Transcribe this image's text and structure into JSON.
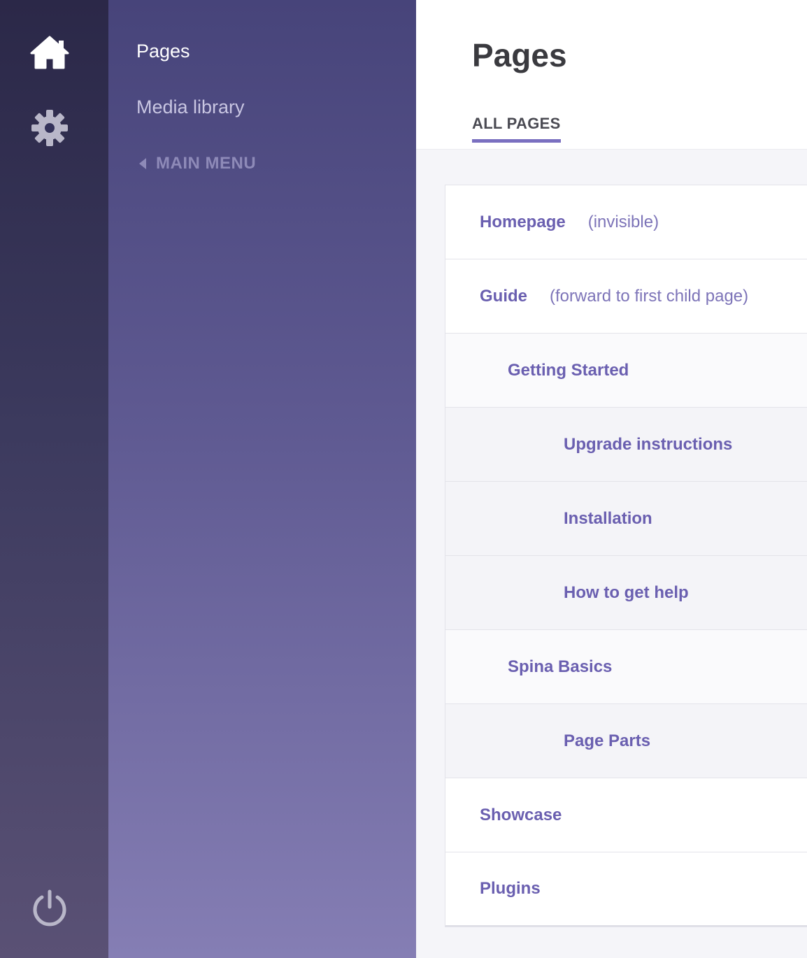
{
  "rail": {
    "icons": [
      "home-icon",
      "gear-icon",
      "power-icon"
    ],
    "color_active": "#ffffff",
    "color_inactive": "#b9b7c9"
  },
  "nav": {
    "pages_label": "Pages",
    "media_label": "Media library",
    "back_label": "MAIN MENU"
  },
  "main": {
    "title": "Pages",
    "tab_label": "ALL PAGES",
    "pages": [
      {
        "name": "Homepage",
        "note": "(invisible)",
        "depth": 0
      },
      {
        "name": "Guide",
        "note": "(forward to first child page)",
        "depth": 0
      },
      {
        "name": "Getting Started",
        "note": "",
        "depth": 1
      },
      {
        "name": "Upgrade instructions",
        "note": "",
        "depth": 2
      },
      {
        "name": "Installation",
        "note": "",
        "depth": 2
      },
      {
        "name": "How to get help",
        "note": "",
        "depth": 2
      },
      {
        "name": "Spina Basics",
        "note": "",
        "depth": 1
      },
      {
        "name": "Page Parts",
        "note": "",
        "depth": 2
      },
      {
        "name": "Showcase",
        "note": "",
        "depth": 0
      },
      {
        "name": "Plugins",
        "note": "",
        "depth": 0
      }
    ]
  },
  "colors": {
    "accent": "#7a6fc0",
    "link": "#6a5fb0"
  }
}
